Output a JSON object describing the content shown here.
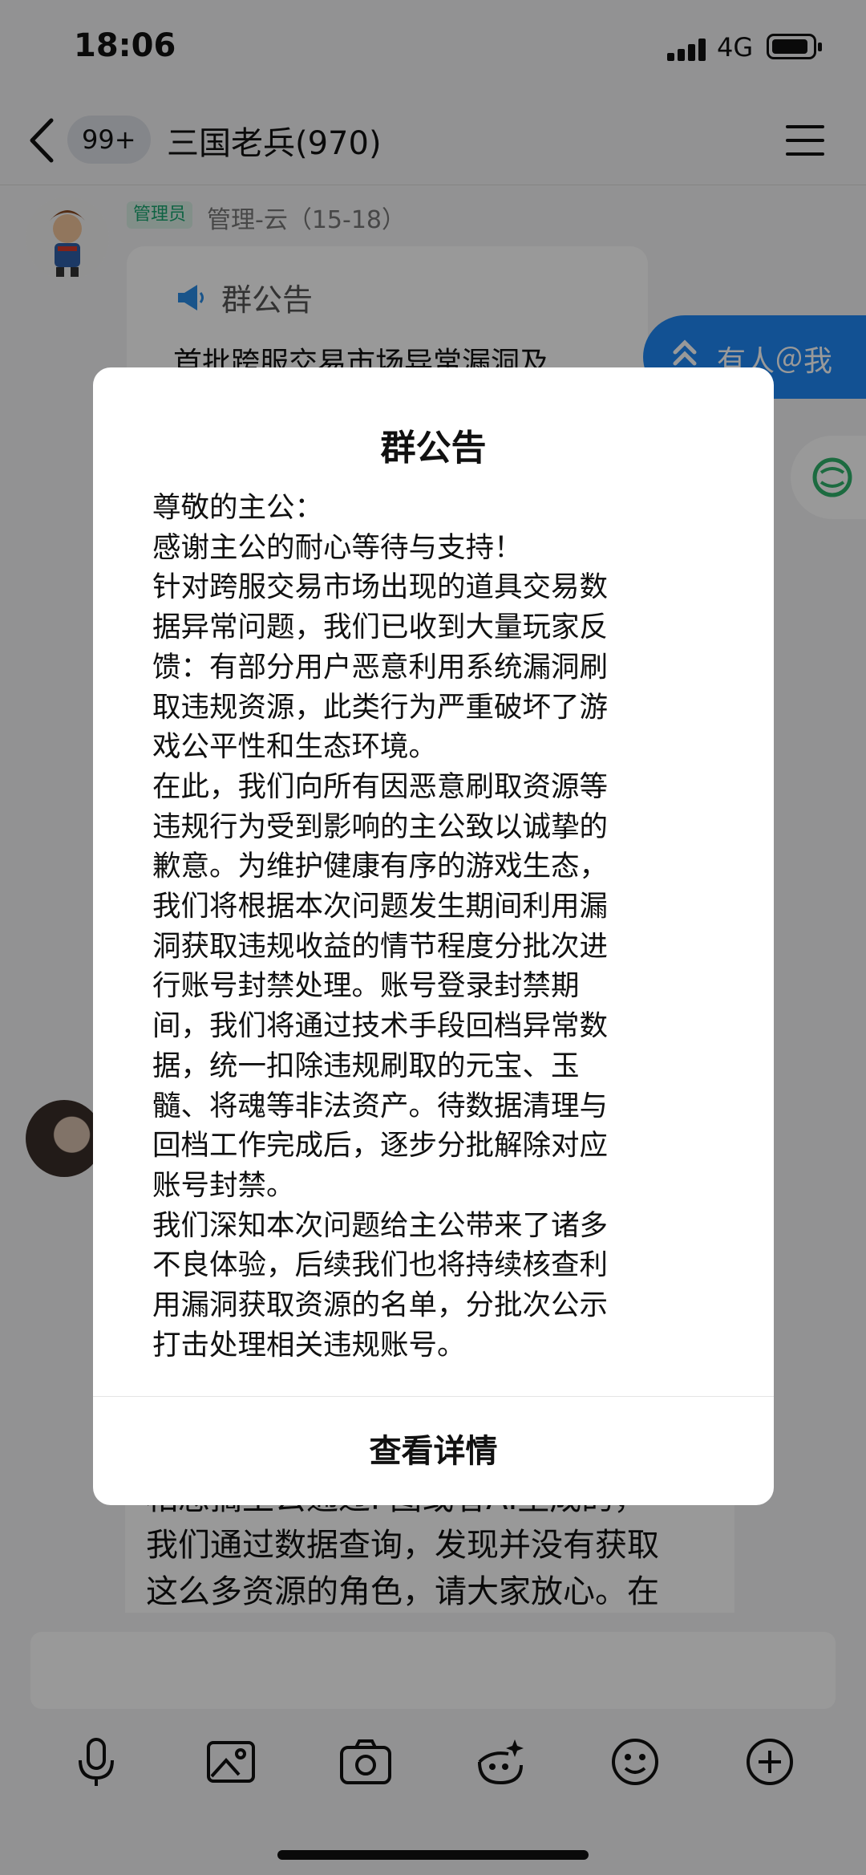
{
  "status_bar": {
    "time": "18:06",
    "network": "4G"
  },
  "nav": {
    "unread_badge": "99+",
    "title": "三国老兵(970)"
  },
  "chat": {
    "admin_role": "管理员",
    "sender_name": "管理-云（15-18）",
    "announcement_card_label": "群公告",
    "announcement_card_preview": "首批跨服交易市场异常漏洞及",
    "at_me_label": "有人＠我",
    "message_lines": [
      "相忽搞王公通过P图或者AI生成的，",
      "我们通过数据查询，发现并没有获取",
      "这么多资源的角色，请大家放心。在"
    ]
  },
  "dialog": {
    "title": "群公告",
    "body_lines": [
      "尊敬的主公：",
      "感谢主公的耐心等待与支持！",
      "针对跨服交易市场出现的道具交易数",
      "据异常问题，我们已收到大量玩家反",
      "馈：有部分用户恶意利用系统漏洞刷",
      "取违规资源，此类行为严重破坏了游",
      "戏公平性和生态环境。",
      "在此，我们向所有因恶意刷取资源等",
      "违规行为受到影响的主公致以诚挚的",
      "歉意。为维护健康有序的游戏生态，",
      "我们将根据本次问题发生期间利用漏",
      "洞获取违规收益的情节程度分批次进",
      "行账号封禁处理。账号登录封禁期",
      "间，我们将通过技术手段回档异常数",
      "据，统一扣除违规刷取的元宝、玉",
      "髓、将魂等非法资产。待数据清理与",
      "回档工作完成后，逐步分批解除对应",
      "账号封禁。",
      "我们深知本次问题给主公带来了诸多",
      "不良体验，后续我们也将持续核查利",
      "用漏洞获取资源的名单，分批次公示",
      "打击处理相关违规账号。"
    ],
    "button_label": "查看详情"
  },
  "colors": {
    "accent_blue": "#1e88f5",
    "admin_green": "#1aa571",
    "overlay": "rgba(0,0,0,0.40)"
  },
  "icons": [
    "back-chevron-icon",
    "menu-icon",
    "megaphone-icon",
    "double-chevron-up-icon",
    "app-logo-icon",
    "microphone-icon",
    "image-icon",
    "camera-icon",
    "sticker-face-icon",
    "emoji-icon",
    "plus-circle-icon"
  ]
}
